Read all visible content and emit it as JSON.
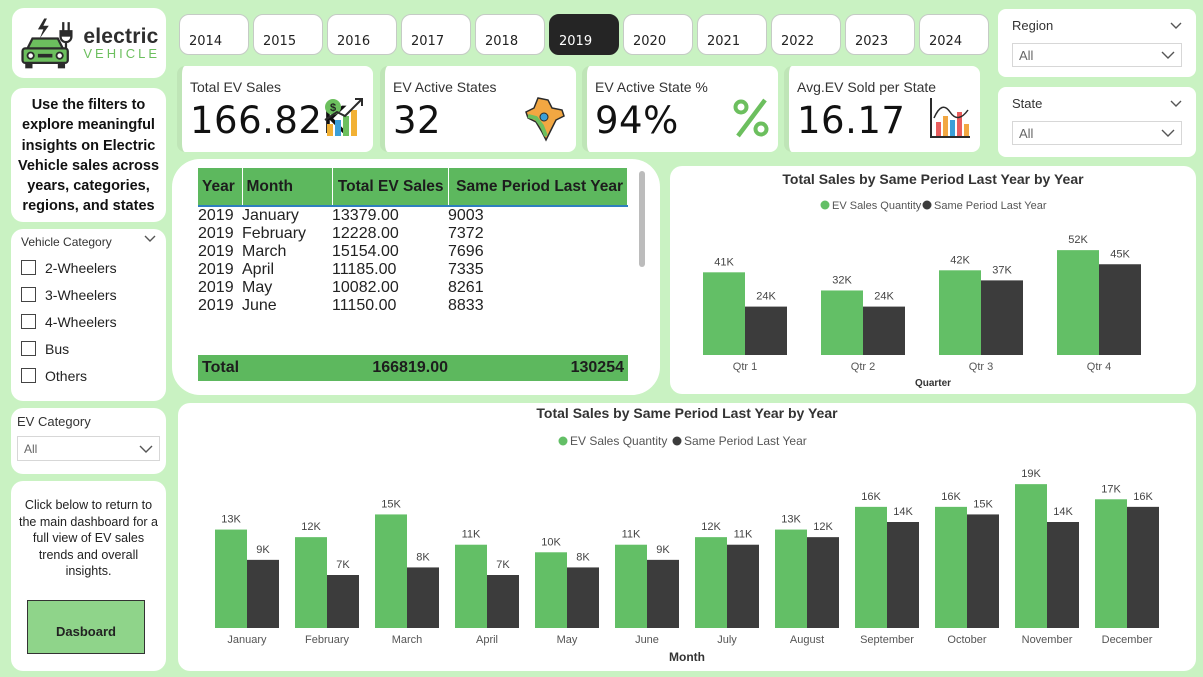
{
  "logo": {
    "line1": "electric",
    "line2": "VEHICLE"
  },
  "years": [
    "2014",
    "2015",
    "2016",
    "2017",
    "2018",
    "2019",
    "2020",
    "2021",
    "2022",
    "2023",
    "2024"
  ],
  "active_year": "2019",
  "filters": {
    "region": {
      "title": "Region",
      "value": "All"
    },
    "state": {
      "title": "State",
      "value": "All"
    },
    "vehicle_category": {
      "title": "Vehicle Category",
      "options": [
        "2-Wheelers",
        "3-Wheelers",
        "4-Wheelers",
        "Bus",
        "Others"
      ]
    },
    "ev_category": {
      "title": "EV Category",
      "value": "All"
    }
  },
  "kpis": [
    {
      "label": "Total EV Sales",
      "value": "166.82K",
      "icon": "money-growth-icon"
    },
    {
      "label": "EV Active States",
      "value": "32",
      "icon": "india-map-icon"
    },
    {
      "label": "EV Active State %",
      "value": "94%",
      "icon": "percent-icon"
    },
    {
      "label": "Avg.EV Sold per State",
      "value": "16.17",
      "icon": "bar-chart-icon"
    }
  ],
  "intro_text": "Use the filters to explore meaningful insights on Electric Vehicle sales across years, categories, regions, and states",
  "back": {
    "text": "Click below to return to the main dashboard for a full view of EV sales trends and overall insights.",
    "button": "Dasboard"
  },
  "table": {
    "headers": [
      "Year",
      "Month",
      "Total EV Sales",
      "Same Period Last Year"
    ],
    "rows": [
      [
        "2019",
        "January",
        "13379.00",
        "9003"
      ],
      [
        "2019",
        "February",
        "12228.00",
        "7372"
      ],
      [
        "2019",
        "March",
        "15154.00",
        "7696"
      ],
      [
        "2019",
        "April",
        "11185.00",
        "7335"
      ],
      [
        "2019",
        "May",
        "10082.00",
        "8261"
      ],
      [
        "2019",
        "June",
        "11150.00",
        "8833"
      ]
    ],
    "total": {
      "label": "Total",
      "sales": "166819.00",
      "last": "130254"
    }
  },
  "chart_data": [
    {
      "type": "bar",
      "title": "Total Sales by Same Period Last Year by Year",
      "xlabel": "Quarter",
      "categories": [
        "Qtr 1",
        "Qtr 2",
        "Qtr 3",
        "Qtr 4"
      ],
      "series": [
        {
          "name": "EV Sales Quantity",
          "values": [
            41,
            32,
            42,
            52
          ],
          "labels": [
            "41K",
            "32K",
            "42K",
            "52K"
          ],
          "color": "#63bf66"
        },
        {
          "name": "Same Period Last Year",
          "values": [
            24,
            24,
            37,
            45
          ],
          "labels": [
            "24K",
            "24K",
            "37K",
            "45K"
          ],
          "color": "#3c3c3c"
        }
      ],
      "ylim": [
        0,
        60
      ],
      "legend": "top-center"
    },
    {
      "type": "bar",
      "title": "Total Sales by Same Period Last Year by Year",
      "xlabel": "Month",
      "categories": [
        "January",
        "February",
        "March",
        "April",
        "May",
        "June",
        "July",
        "August",
        "September",
        "October",
        "November",
        "December"
      ],
      "series": [
        {
          "name": "EV Sales Quantity",
          "values": [
            13,
            12,
            15,
            11,
            10,
            11,
            12,
            13,
            16,
            16,
            19,
            17
          ],
          "labels": [
            "13K",
            "12K",
            "15K",
            "11K",
            "10K",
            "11K",
            "12K",
            "13K",
            "16K",
            "16K",
            "19K",
            "17K"
          ],
          "color": "#63bf66"
        },
        {
          "name": "Same Period Last Year",
          "values": [
            9,
            7,
            8,
            7,
            8,
            9,
            11,
            12,
            14,
            15,
            14,
            16
          ],
          "labels": [
            "9K",
            "7K",
            "8K",
            "7K",
            "8K",
            "9K",
            "11K",
            "12K",
            "14K",
            "15K",
            "14K",
            "16K"
          ],
          "color": "#3c3c3c"
        }
      ],
      "ylim": [
        0,
        21
      ],
      "legend": "top-center"
    }
  ]
}
